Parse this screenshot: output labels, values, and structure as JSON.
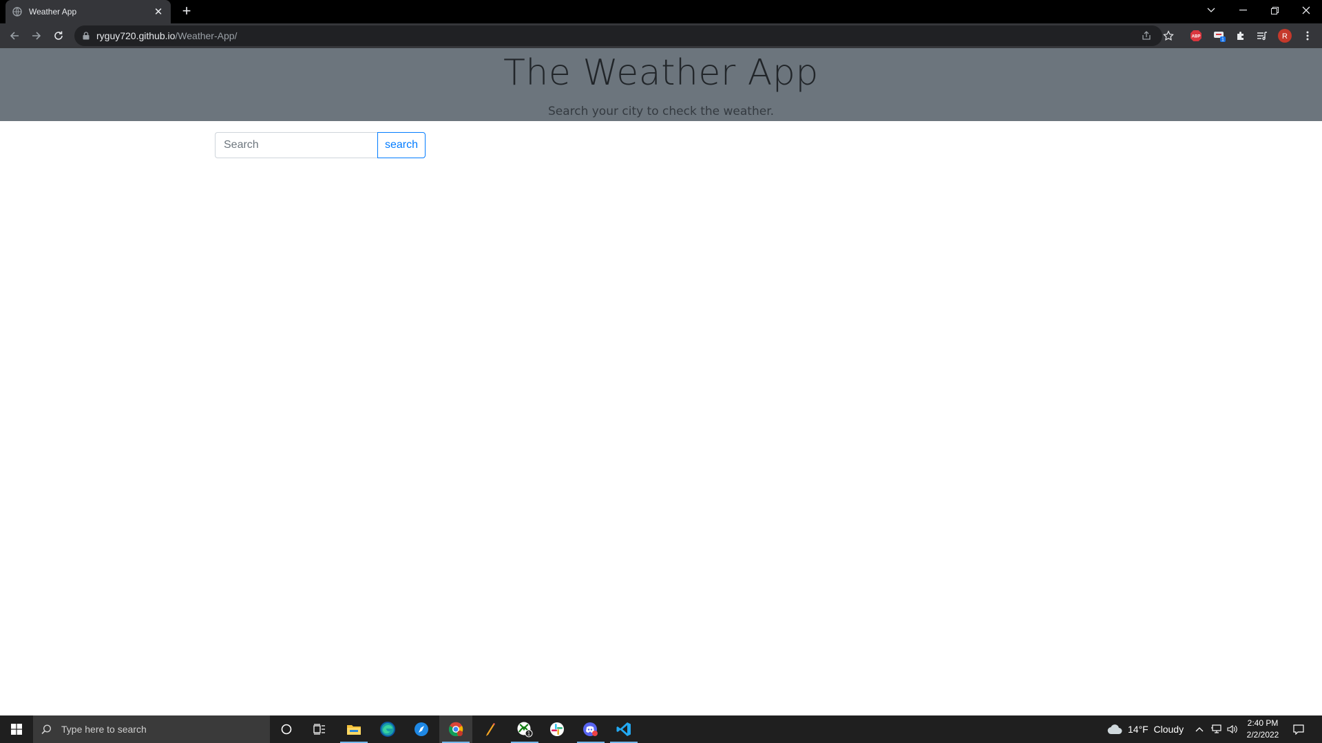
{
  "browser": {
    "tab_title": "Weather App",
    "url_host": "ryguy720.github.io",
    "url_path": "/Weather-App/",
    "profile_initial": "R",
    "abp_label": "ABP",
    "ext_badge": "1"
  },
  "page": {
    "title": "The Weather App",
    "subtitle": "Search your city to check the weather.",
    "search_placeholder": "Search",
    "search_value": "",
    "search_button": "search"
  },
  "taskbar": {
    "search_placeholder": "Type here to search",
    "weather": "14°F  Cloudy",
    "time": "2:40 PM",
    "date": "2/2/2022",
    "xbox_badge": "1"
  },
  "colors": {
    "jumbotron_bg": "#6c757d",
    "button_accent": "#007bff",
    "chrome_dark": "#35363a"
  }
}
